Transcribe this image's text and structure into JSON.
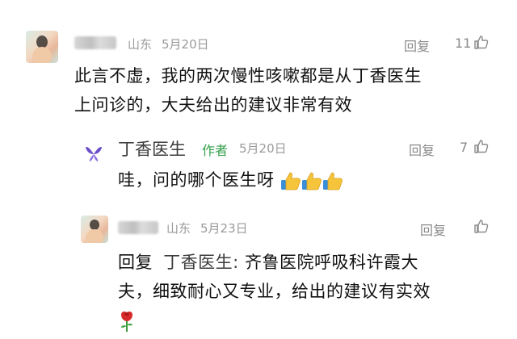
{
  "comments": [
    {
      "user_name": "",
      "location": "山东",
      "date": "5月20日",
      "reply_label": "回复",
      "likes": "11",
      "text_lines": [
        "此言不虚，我的两次慢性咳嗽都是从丁香医生",
        "上问诊的，大夫给出的建议非常有效"
      ]
    },
    {
      "user_name": "丁香医生",
      "badge": "作者",
      "date": "5月20日",
      "reply_label": "回复",
      "likes": "7",
      "text": "哇，问的哪个医生呀",
      "emojis": [
        "thumbs-up-emoji",
        "thumbs-up-emoji",
        "thumbs-up-emoji"
      ]
    },
    {
      "user_name": "",
      "location": "山东",
      "date": "5月23日",
      "reply_label": "回复",
      "likes": "",
      "reply_prefix": "回复",
      "mention": "丁香医生:",
      "text_line1": "齐鲁医院呼吸科许霞大",
      "text_line2": "夫，细致耐心又专业，给出的建议有实效",
      "emoji": "rose-emoji"
    }
  ],
  "colors": {
    "brand_green": "#33a04a",
    "brand_purple": "#6b4fc9",
    "meta_gray": "#9a9a9a"
  }
}
